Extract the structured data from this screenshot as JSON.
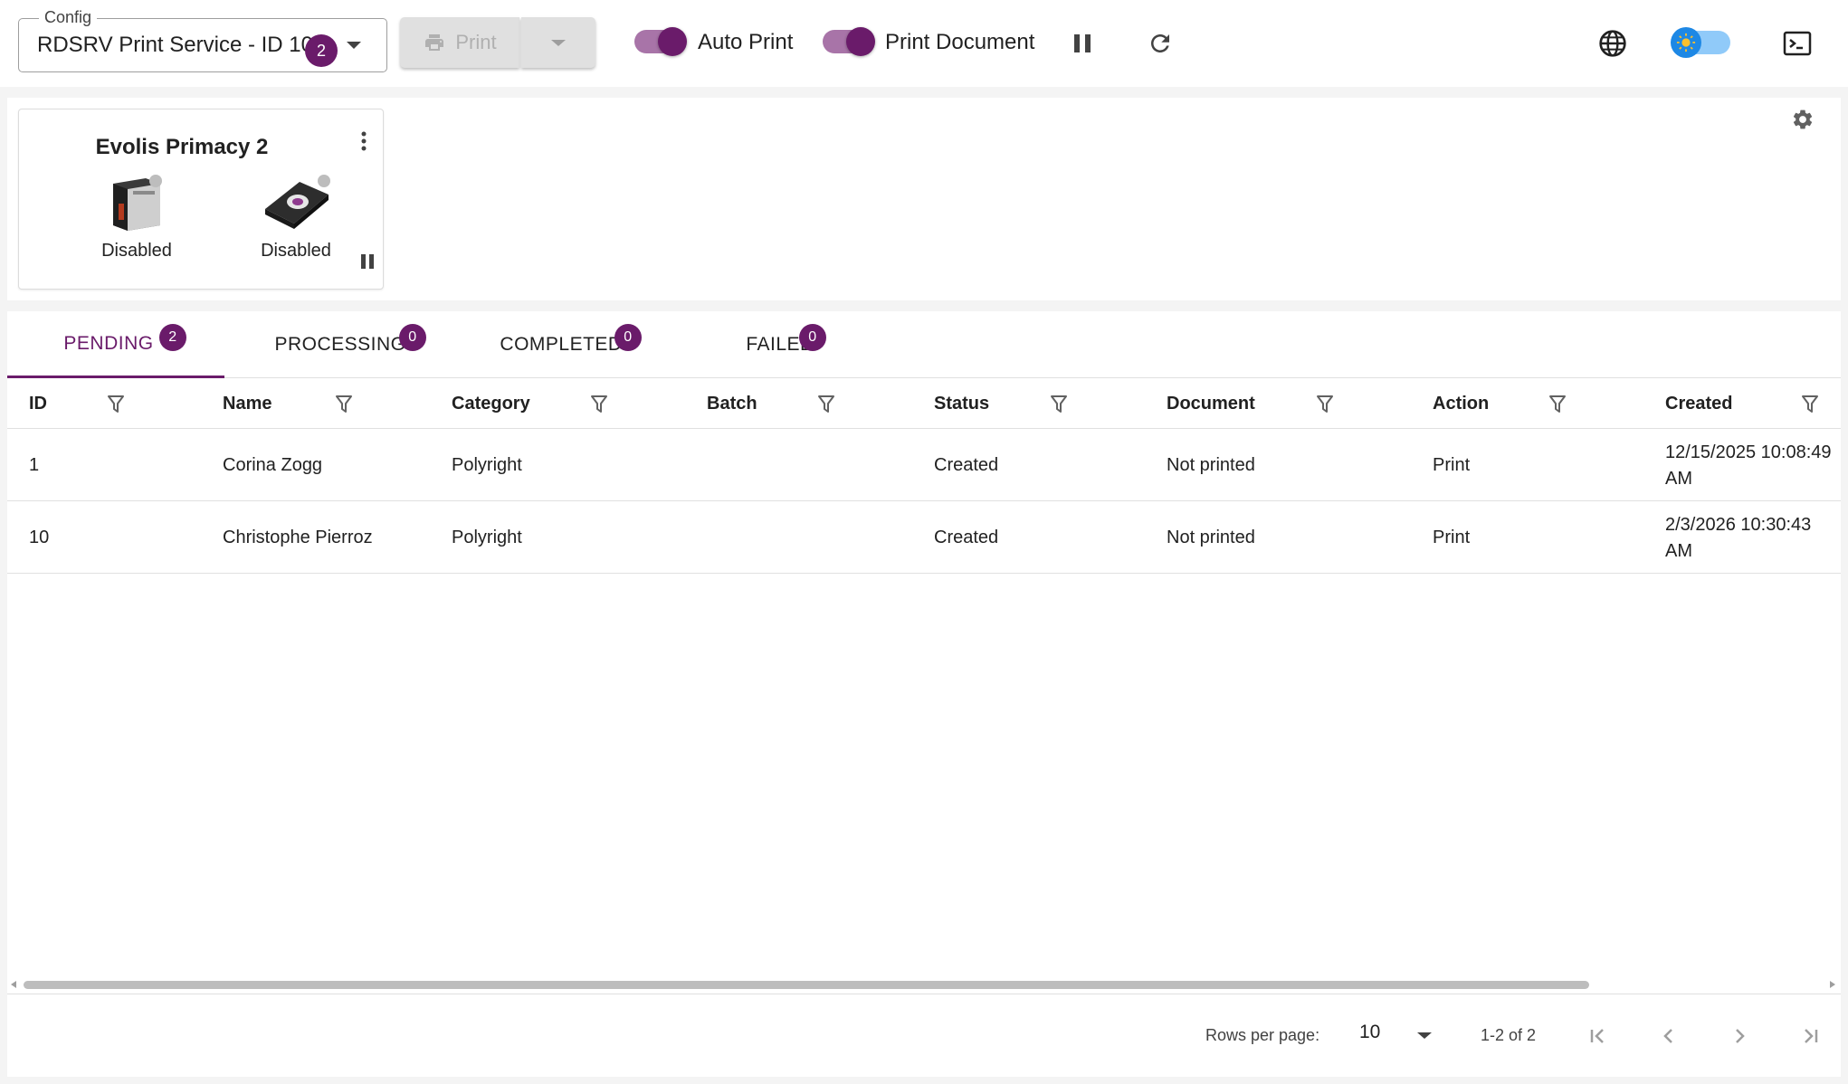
{
  "topbar": {
    "config_label": "Config",
    "config_value": "RDSRV Print Service - ID 10",
    "config_badge": "2",
    "print_label": "Print",
    "auto_print_label": "Auto Print",
    "print_document_label": "Print Document"
  },
  "printer": {
    "name": "Evolis Primacy 2",
    "devices": [
      {
        "label": "Disabled"
      },
      {
        "label": "Disabled"
      }
    ]
  },
  "tabs": [
    {
      "label": "PENDING",
      "count": "2"
    },
    {
      "label": "PROCESSING",
      "count": "0"
    },
    {
      "label": "COMPLETED",
      "count": "0"
    },
    {
      "label": "FAILED",
      "count": "0"
    }
  ],
  "table": {
    "headers": [
      "ID",
      "Name",
      "Category",
      "Batch",
      "Status",
      "Document",
      "Action",
      "Created"
    ],
    "rows": [
      {
        "id": "1",
        "name": "Corina Zogg",
        "category": "Polyright",
        "batch": "",
        "status": "Created",
        "document": "Not printed",
        "action": "Print",
        "created": "12/15/2025 10:08:49 AM"
      },
      {
        "id": "10",
        "name": "Christophe Pierroz",
        "category": "Polyright",
        "batch": "",
        "status": "Created",
        "document": "Not printed",
        "action": "Print",
        "created": "2/3/2026 10:30:43 AM"
      }
    ]
  },
  "footer": {
    "rows_per_page_label": "Rows per page:",
    "rows_per_page_value": "10",
    "range": "1-2 of 2"
  },
  "colors": {
    "accent": "#6a1b6a",
    "toggle_track": "#a874a8",
    "theme_toggle": "#1e88e5"
  }
}
